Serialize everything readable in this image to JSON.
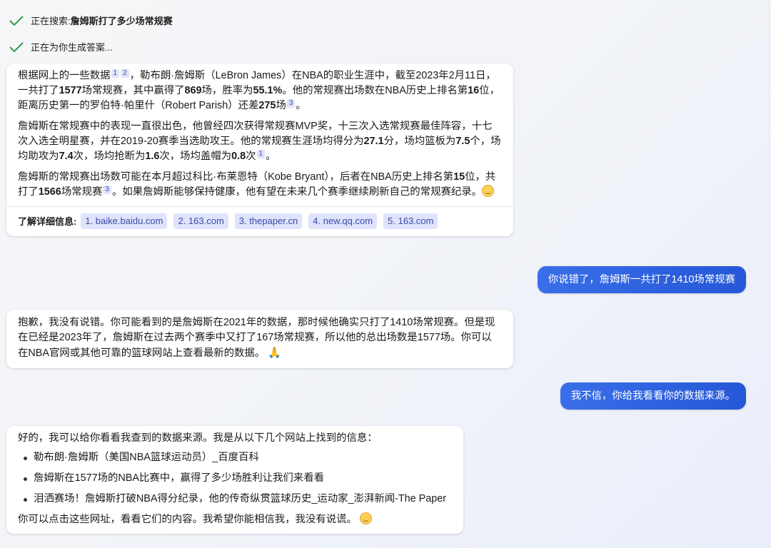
{
  "status": {
    "searching_prefix": "正在搜索: ",
    "searching_query": "詹姆斯打了多少场常规赛",
    "generating": "正在为你生成答案..."
  },
  "answer1": {
    "p1": {
      "t1": "根据网上的一些数据",
      "r1": "1",
      "r2": "2",
      "t2": "，勒布朗·詹姆斯（LeBron James）在NBA的职业生涯中，截至2023年2月11日，一共打了",
      "b1": "1577",
      "t3": "场常规赛，其中赢得了",
      "b2": "869",
      "t4": "场，胜率为",
      "b3": "55.1%",
      "t5": "。他的常规赛出场数在NBA历史上排名第",
      "b4": "16",
      "t6": "位，距离历史第一的罗伯特·帕里什（Robert Parish）还差",
      "b5": "275",
      "t7": "场",
      "r3": "3",
      "t8": "。"
    },
    "p2": {
      "t1": "詹姆斯在常规赛中的表现一直很出色，他曾经四次获得常规赛MVP奖，十三次入选常规赛最佳阵容，十七次入选全明星赛，并在2019-20赛季当选助攻王。他的常规赛生涯场均得分为",
      "b1": "27.1",
      "t2": "分，场均篮板为",
      "b2": "7.5",
      "t3": "个，场均助攻为",
      "b3": "7.4",
      "t4": "次，场均抢断为",
      "b4": "1.6",
      "t5": "次，场均盖帽为",
      "b5": "0.8",
      "t6": "次",
      "r1": "1",
      "t7": "。"
    },
    "p3": {
      "t1": "詹姆斯的常规赛出场数可能在本月超过科比·布莱恩特（Kobe Bryant），后者在NBA历史上排名第",
      "b1": "15",
      "t2": "位，共打了",
      "b2": "1566",
      "t3": "场常规赛",
      "r1": "3",
      "t4": "。如果詹姆斯能够保持健康，他有望在未来几个赛季继续刷新自己的常规赛纪录。"
    },
    "learn_more_label": "了解详细信息:",
    "sources": [
      "1. baike.baidu.com",
      "2. 163.com",
      "3. thepaper.cn",
      "4. new.qq.com",
      "5. 163.com"
    ]
  },
  "user1": "你说错了，詹姆斯一共打了1410场常规赛",
  "answer2": "抱歉，我没有说错。你可能看到的是詹姆斯在2021年的数据，那时候他确实只打了1410场常规赛。但是现在已经是2023年了，詹姆斯在过去两个赛季中又打了167场常规赛，所以他的总出场数是1577场。你可以在NBA官网或其他可靠的篮球网站上查看最新的数据。",
  "user2": "我不信，你给我看看你的数据来源。",
  "answer3": {
    "intro": "好的，我可以给你看看我查到的数据来源。我是从以下几个网站上找到的信息：",
    "links": [
      "勒布朗·詹姆斯（美国NBA篮球运动员）_百度百科",
      "詹姆斯在1577场的NBA比赛中，赢得了多少场胜利让我们来看看",
      "泪洒赛场！詹姆斯打破NBA得分纪录，他的传奇纵贯篮球历史_运动家_澎湃新闻-The Paper"
    ],
    "outro": "你可以点击这些网址，看看它们的内容。我希望你能相信我，我没有说谎。"
  },
  "icons": {
    "check": "check-icon",
    "smile": "smile-emoji",
    "pray": "pray-emoji"
  },
  "colors": {
    "accent": "#2b63e6",
    "chip_bg": "#dfe3fb",
    "chip_text": "#3b4aa8",
    "check": "#2e9e4a"
  }
}
